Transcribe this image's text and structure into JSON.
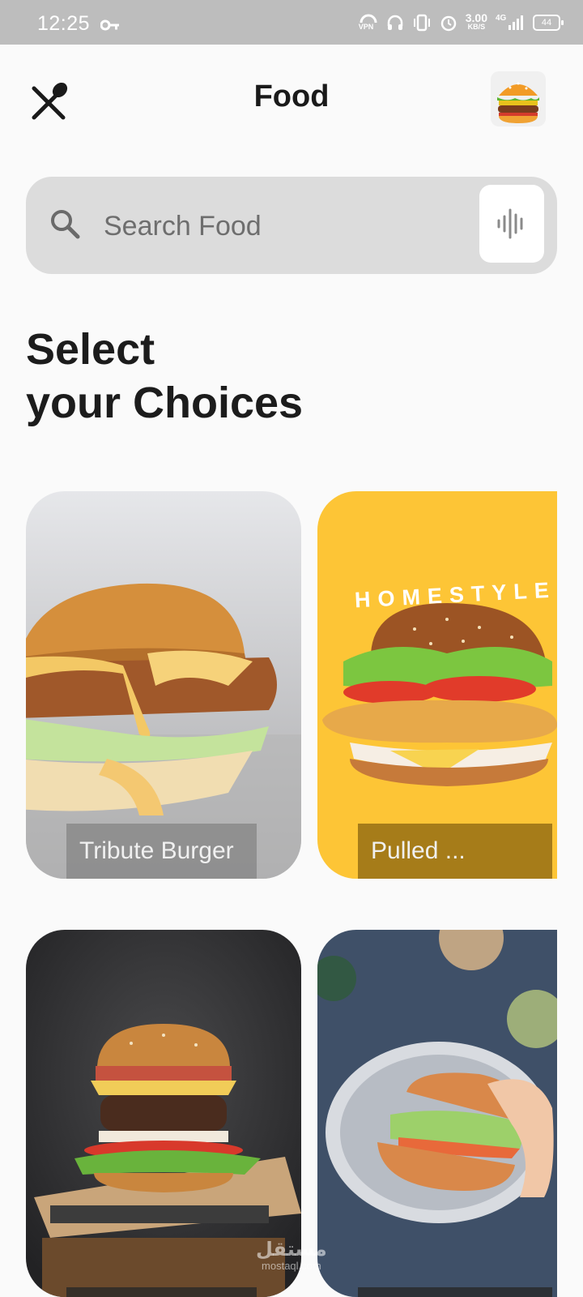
{
  "status_bar": {
    "time": "12:25",
    "net_speed_value": "3.00",
    "net_speed_unit": "KB/S",
    "network": "4G",
    "battery": "44",
    "vpn": "VPN"
  },
  "header": {
    "title": "Food"
  },
  "search": {
    "placeholder": "Search Food"
  },
  "section": {
    "title_line1": "Select",
    "title_line2": "your Choices"
  },
  "cards": [
    {
      "label": "Tribute Burger"
    },
    {
      "label": "Pulled ..."
    },
    {
      "label": ""
    },
    {
      "label": ""
    }
  ],
  "watermark": {
    "arabic": "مستقل",
    "latin": "mostaql.com"
  },
  "colors": {
    "background": "#fafafa",
    "status_bar": "#bdbdbd",
    "search_bg": "#dcdcdc",
    "card_yellow": "#fdc536"
  }
}
